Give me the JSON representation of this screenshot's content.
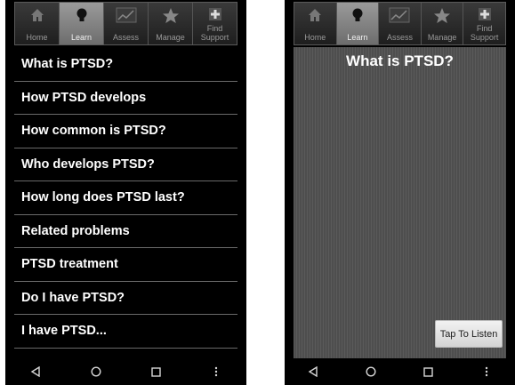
{
  "tabs": [
    {
      "label": "Home",
      "icon": "home-icon"
    },
    {
      "label": "Learn",
      "icon": "lightbulb-icon"
    },
    {
      "label": "Assess",
      "icon": "chart-icon"
    },
    {
      "label": "Manage",
      "icon": "star-icon"
    },
    {
      "label": "Find\nSupport",
      "icon": "plus-icon"
    }
  ],
  "active_tab": "Learn",
  "learn_menu": {
    "items": [
      "What is PTSD?",
      "How PTSD develops",
      "How common is PTSD?",
      "Who develops PTSD?",
      "How long does PTSD last?",
      "Related problems",
      "PTSD treatment",
      "Do I have PTSD?",
      "I have PTSD..."
    ]
  },
  "detail": {
    "title": "What is PTSD?",
    "listen_button": "Tap To Listen"
  },
  "navbar": [
    "back-icon",
    "home-circle-icon",
    "recents-icon",
    "more-icon"
  ]
}
